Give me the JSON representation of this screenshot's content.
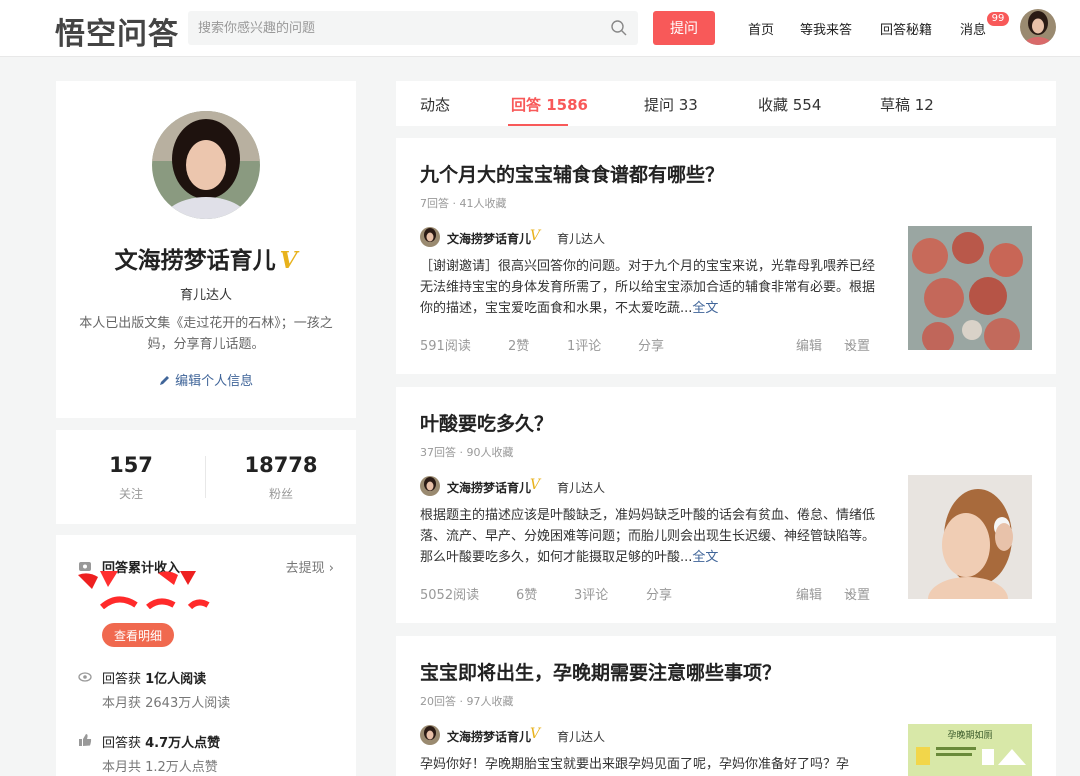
{
  "header": {
    "logo": "悟空问答",
    "search_placeholder": "搜索你感兴趣的问题",
    "ask_label": "提问",
    "nav": [
      "首页",
      "等我来答",
      "回答秘籍",
      "消息"
    ],
    "badge": "99"
  },
  "profile": {
    "name": "文海捞梦话育儿",
    "v": "V",
    "tag": "育儿达人",
    "bio": "本人已出版文集《走过花开的石林》；一孩之妈，分享育儿话题。",
    "edit": "编辑个人信息"
  },
  "stats": [
    {
      "num": "157",
      "label": "关注"
    },
    {
      "num": "18778",
      "label": "粉丝"
    }
  ],
  "income": {
    "title": "回答累计收入",
    "withdraw": "去提现",
    "detail": "查看明细",
    "reads_title_pre": "回答获 ",
    "reads_title_num": "1亿人阅读",
    "reads_sub": "本月获 2643万人阅读",
    "likes_title_pre": "回答获 ",
    "likes_title_num": "4.7万人点赞",
    "likes_sub": "本月共 1.2万人点赞"
  },
  "tabs": [
    "动态",
    "回答 1586",
    "提问 33",
    "收藏 554",
    "草稿 12"
  ],
  "answers": [
    {
      "title": "九个月大的宝宝辅食食谱都有哪些？",
      "meta": "7回答 · 41人收藏",
      "author": "文海捞梦话育儿",
      "v": "V",
      "tag": "育儿达人",
      "excerpt": "［谢谢邀请］很高兴回答你的问题。对于九个月的宝宝来说，光靠母乳喂养已经无法维持宝宝的身体发育所需了，所以给宝宝添加合适的辅食非常有必要。根据你的描述，宝宝爱吃面食和水果，不太爱吃蔬...",
      "more": "全文",
      "reads": "591阅读",
      "likes": "2赞",
      "comments": "1评论",
      "share": "分享",
      "edit": "编辑",
      "settings": "设置"
    },
    {
      "title": "叶酸要吃多久？",
      "meta": "37回答 · 90人收藏",
      "author": "文海捞梦话育儿",
      "v": "V",
      "tag": "育儿达人",
      "excerpt": "根据题主的描述应该是叶酸缺乏，准妈妈缺乏叶酸的话会有贫血、倦怠、情绪低落、流产、早产、分娩困难等问题；而胎儿则会出现生长迟缓、神经管缺陷等。那么叶酸要吃多久，如何才能摄取足够的叶酸...",
      "more": "全文",
      "reads": "5052阅读",
      "likes": "6赞",
      "comments": "3评论",
      "share": "分享",
      "edit": "编辑",
      "settings": "设置"
    },
    {
      "title": "宝宝即将出生，孕晚期需要注意哪些事项？",
      "meta": "20回答 · 97人收藏",
      "author": "文海捞梦话育儿",
      "v": "V",
      "tag": "育儿达人",
      "excerpt": "孕妈你好！孕晚期胎宝宝就要出来跟孕妈见面了呢，孕妈你准备好了吗？孕",
      "thumb_text": "孕晚期如厕"
    }
  ],
  "colors": {
    "accent": "#f85959",
    "link": "#406599",
    "v": "#e8b21c"
  }
}
